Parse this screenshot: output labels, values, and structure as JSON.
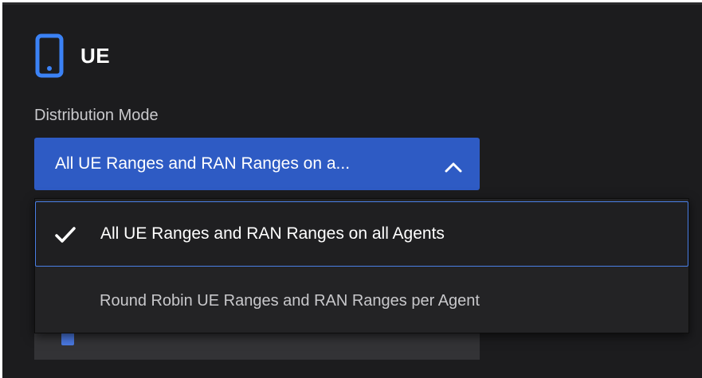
{
  "section": {
    "title": "UE",
    "icon": "phone-icon"
  },
  "distribution": {
    "label": "Distribution Mode",
    "selected_display": "All UE Ranges and RAN Ranges on a...",
    "expanded": true,
    "options": [
      {
        "label": "All UE Ranges and RAN Ranges on all Agents",
        "selected": true
      },
      {
        "label": "Round Robin UE Ranges and RAN Ranges per Agent",
        "selected": false
      }
    ]
  },
  "colors": {
    "accent": "#2e5bc4",
    "icon": "#3b82f6",
    "background": "#1c1c1e"
  }
}
